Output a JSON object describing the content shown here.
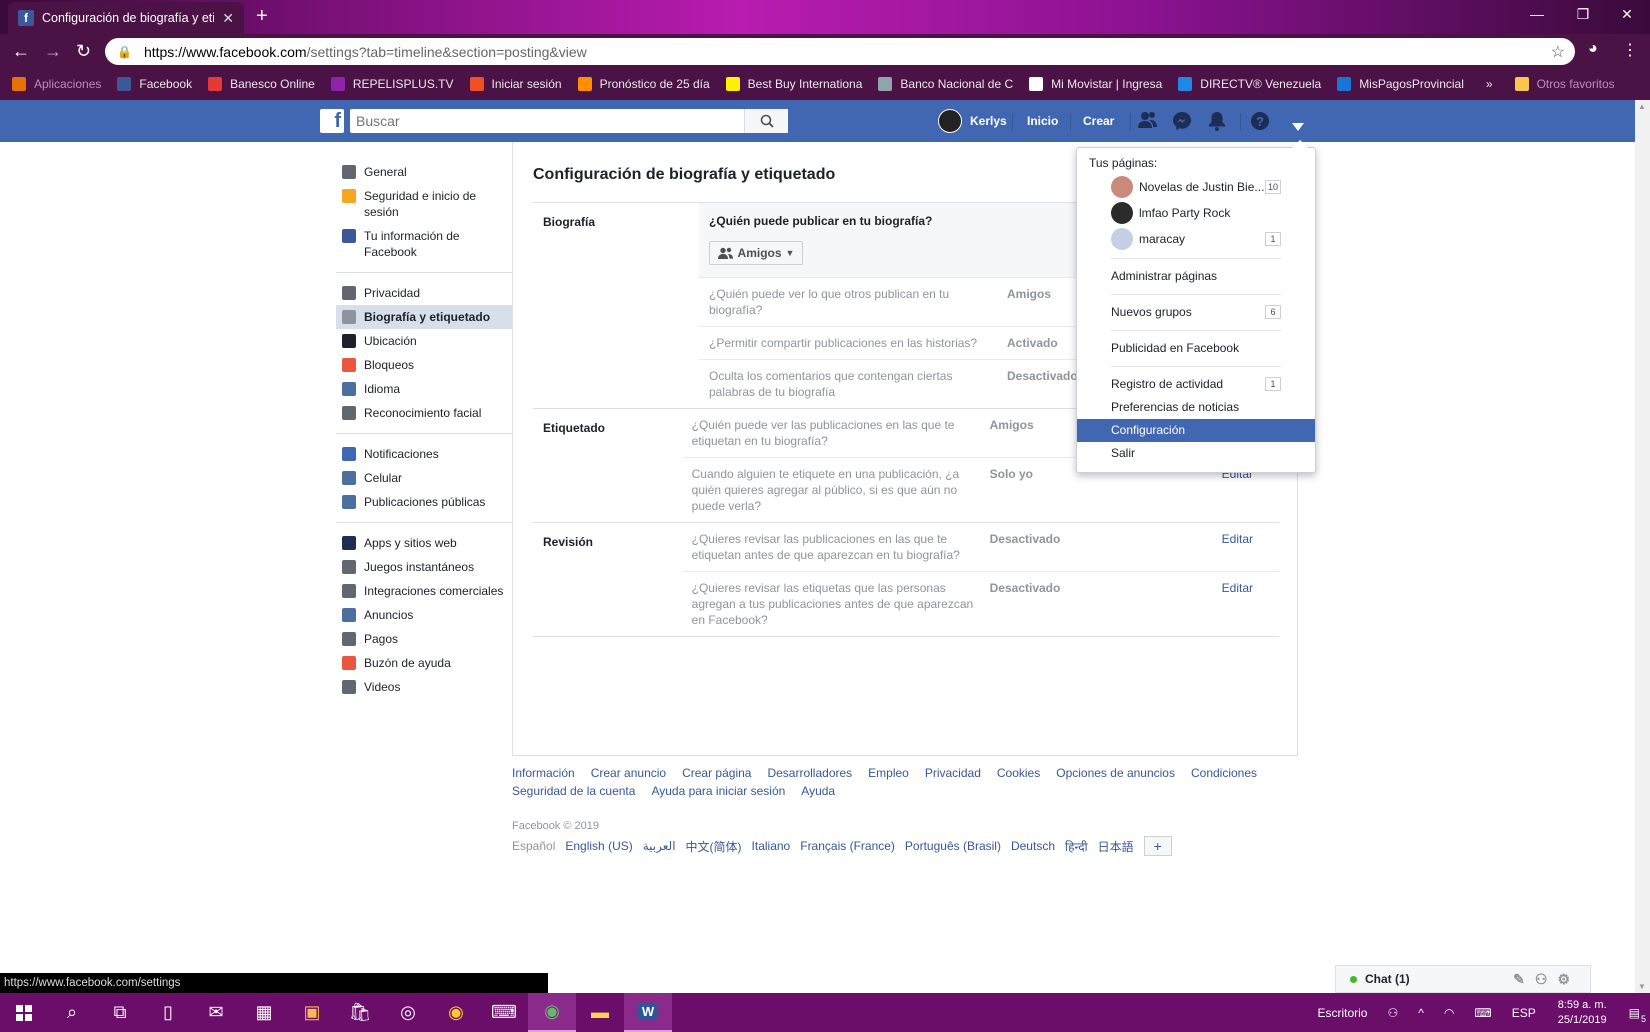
{
  "browser": {
    "tab_title": "Configuración de biografía y etiq",
    "url_host": "https://www.facebook.com",
    "url_path": "/settings?tab=timeline&section=posting&view",
    "bookmarks": [
      {
        "label": "Aplicaciones",
        "color": "#e57200",
        "dim": true
      },
      {
        "label": "Facebook",
        "color": "#3b5998",
        "dim": false
      },
      {
        "label": "Banesco Online",
        "color": "#e53935",
        "dim": false
      },
      {
        "label": "REPELISPLUS.TV",
        "color": "#8e24aa",
        "dim": false
      },
      {
        "label": "Iniciar sesión",
        "color": "#f25022",
        "dim": false
      },
      {
        "label": "Pronóstico de 25 día",
        "color": "#ff8f00",
        "dim": false
      },
      {
        "label": "Best Buy Internationa",
        "color": "#fff200",
        "dim": false
      },
      {
        "label": "Banco Nacional de C",
        "color": "#90a4ae",
        "dim": false
      },
      {
        "label": "Mi Movistar | Ingresa",
        "color": "#ffffff",
        "dim": false
      },
      {
        "label": "DIRECTV® Venezuela",
        "color": "#1e88e5",
        "dim": false
      },
      {
        "label": "MisPagosProvincial",
        "color": "#1976d2",
        "dim": false
      }
    ],
    "bookmarks_more": "»",
    "other_bookmarks": "Otros favoritos"
  },
  "fb": {
    "search_placeholder": "Buscar",
    "user_name": "Kerlys",
    "home": "Inicio",
    "create": "Crear"
  },
  "sidebar": {
    "groups": [
      [
        {
          "label": "General",
          "icon": "gear-icon",
          "color": "#606770"
        },
        {
          "label": "Seguridad e inicio de sesión",
          "icon": "shield-icon",
          "color": "#f5a623"
        },
        {
          "label": "Tu información de Facebook",
          "icon": "facebook-icon",
          "color": "#3b5998"
        }
      ],
      [
        {
          "label": "Privacidad",
          "icon": "lock-icon",
          "color": "#606770"
        },
        {
          "label": "Biografía y etiquetado",
          "icon": "timeline-icon",
          "color": "#8d949e",
          "active": true
        },
        {
          "label": "Ubicación",
          "icon": "location-icon",
          "color": "#1d2129"
        },
        {
          "label": "Bloqueos",
          "icon": "block-icon",
          "color": "#e9573f"
        },
        {
          "label": "Idioma",
          "icon": "language-icon",
          "color": "#4b6f9e"
        },
        {
          "label": "Reconocimiento facial",
          "icon": "face-icon",
          "color": "#606770"
        }
      ],
      [
        {
          "label": "Notificaciones",
          "icon": "globe-icon",
          "color": "#4267b2"
        },
        {
          "label": "Celular",
          "icon": "phone-icon",
          "color": "#4b6f9e"
        },
        {
          "label": "Publicaciones públicas",
          "icon": "rss-icon",
          "color": "#4b6f9e"
        }
      ],
      [
        {
          "label": "Apps y sitios web",
          "icon": "apps-icon",
          "color": "#1d2d55"
        },
        {
          "label": "Juegos instantáneos",
          "icon": "gamepad-icon",
          "color": "#606770"
        },
        {
          "label": "Integraciones comerciales",
          "icon": "integrations-icon",
          "color": "#606770"
        },
        {
          "label": "Anuncios",
          "icon": "ads-icon",
          "color": "#4b6f9e"
        },
        {
          "label": "Pagos",
          "icon": "card-icon",
          "color": "#606770"
        },
        {
          "label": "Buzón de ayuda",
          "icon": "lifebuoy-icon",
          "color": "#e9573f"
        },
        {
          "label": "Videos",
          "icon": "video-icon",
          "color": "#606770"
        }
      ]
    ]
  },
  "main": {
    "title": "Configuración de biografía y etiquetado",
    "biografia": {
      "label": "Biografía",
      "expanded_question": "¿Quién puede publicar en tu biografía?",
      "audience": "Amigos",
      "rows": [
        {
          "q": "¿Quién puede ver lo que otros publican en tu biografía?",
          "v": "Amigos",
          "e": ""
        },
        {
          "q": "¿Permitir compartir publicaciones en las historias?",
          "v": "Activado",
          "e": ""
        },
        {
          "q": "Oculta los comentarios que contengan ciertas palabras de tu biografía",
          "v": "Desactivado",
          "e": ""
        }
      ]
    },
    "etiquetado": {
      "label": "Etiquetado",
      "rows": [
        {
          "q": "¿Quién puede ver las publicaciones en las que te etiquetan en tu biografía?",
          "v": "Amigos",
          "e": ""
        },
        {
          "q": "Cuando alguien te etiquete en una publicación, ¿a quién quieres agregar al público, si es que aún no puede verla?",
          "v": "Solo yo",
          "e": "Editar"
        }
      ]
    },
    "revision": {
      "label": "Revisión",
      "rows": [
        {
          "q": "¿Quieres revisar las publicaciones en las que te etiquetan antes de que aparezcan en tu biografía?",
          "v": "Desactivado",
          "e": "Editar"
        },
        {
          "q": "¿Quieres revisar las etiquetas que las personas agregan a tus publicaciones antes de que aparezcan en Facebook?",
          "v": "Desactivado",
          "e": "Editar"
        }
      ]
    }
  },
  "footer": {
    "links1": [
      "Información",
      "Crear anuncio",
      "Crear página",
      "Desarrolladores",
      "Empleo",
      "Privacidad",
      "Cookies",
      "Opciones de anuncios",
      "Condiciones"
    ],
    "links2": [
      "Seguridad de la cuenta",
      "Ayuda para iniciar sesión",
      "Ayuda"
    ],
    "copyright": "Facebook © 2019",
    "current_lang": "Español",
    "langs": [
      "English (US)",
      "العربية",
      "中文(简体)",
      "Italiano",
      "Français (France)",
      "Português (Brasil)",
      "Deutsch",
      "हिन्दी",
      "日本語"
    ],
    "more_langs": "+"
  },
  "dropdown": {
    "header": "Tus páginas:",
    "pages": [
      {
        "name": "Novelas de Justin Bie...",
        "badge": "10",
        "color": "#c98a7a"
      },
      {
        "name": "lmfao Party Rock",
        "badge": "",
        "color": "#2b2b2b"
      },
      {
        "name": "maracay",
        "badge": "1",
        "color": "#c5d0e6"
      }
    ],
    "items": [
      {
        "label": "Administrar páginas",
        "badge": "",
        "sep_after": true
      },
      {
        "label": "Nuevos grupos",
        "badge": "6",
        "sep_after": true
      },
      {
        "label": "Publicidad en Facebook",
        "badge": "",
        "sep_after": true
      },
      {
        "label": "Registro de actividad",
        "badge": "1",
        "sep_after": false
      },
      {
        "label": "Preferencias de noticias",
        "badge": "",
        "sep_after": false
      },
      {
        "label": "Configuración",
        "badge": "",
        "active": true,
        "sep_after": false
      },
      {
        "label": "Salir",
        "badge": "",
        "sep_after": false
      }
    ]
  },
  "status": {
    "hover_url": "https://www.facebook.com/settings"
  },
  "chat": {
    "label": "Chat (1)"
  },
  "taskbar": {
    "desktop": "Escritorio",
    "lang": "ESP",
    "time": "8:59 a. m.",
    "date": "25/1/2019",
    "notif_count": "5"
  }
}
